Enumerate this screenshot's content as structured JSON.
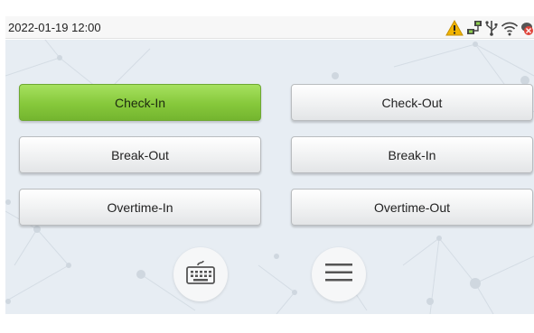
{
  "status_bar": {
    "datetime": "2022-01-19 12:00",
    "icons": [
      "warning-icon",
      "network-icon",
      "usb-icon",
      "wifi-icon",
      "cloud-disconnected-icon"
    ]
  },
  "attendance_buttons": {
    "check_in": "Check-In",
    "check_out": "Check-Out",
    "break_out": "Break-Out",
    "break_in": "Break-In",
    "overtime_in": "Overtime-In",
    "overtime_out": "Overtime-Out",
    "selected": "Check-In"
  },
  "bottom_controls": {
    "icons": [
      "keyboard-icon",
      "menu-icon"
    ]
  },
  "colors": {
    "active_button": "#86c83b",
    "warning": "#f1b400",
    "cloud_alert": "#e0443a",
    "background": "#e7edf3"
  }
}
